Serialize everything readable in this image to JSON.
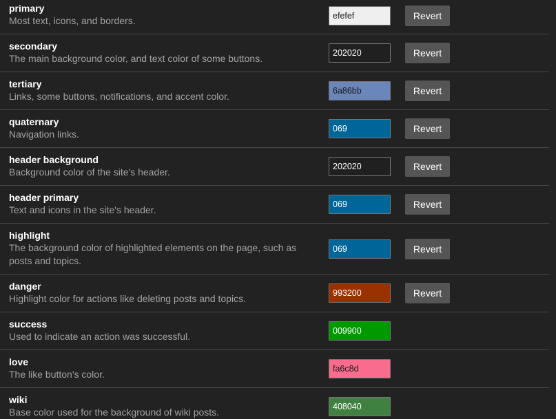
{
  "revert_label": "Revert",
  "colors": [
    {
      "name": "primary",
      "description": "Most text, icons, and borders.",
      "value": "efefef",
      "swatch_bg": "#efefef",
      "swatch_fg": "#222222",
      "has_revert": true
    },
    {
      "name": "secondary",
      "description": "The main background color, and text color of some buttons.",
      "value": "202020",
      "swatch_bg": "#202020",
      "swatch_fg": "#ffffff",
      "has_revert": true
    },
    {
      "name": "tertiary",
      "description": "Links, some buttons, notifications, and accent color.",
      "value": "6a86bb",
      "swatch_bg": "#6a86bb",
      "swatch_fg": "#1a1a1a",
      "has_revert": true
    },
    {
      "name": "quaternary",
      "description": "Navigation links.",
      "value": "069",
      "swatch_bg": "#006699",
      "swatch_fg": "#ffffff",
      "has_revert": true
    },
    {
      "name": "header background",
      "description": "Background color of the site's header.",
      "value": "202020",
      "swatch_bg": "#202020",
      "swatch_fg": "#ffffff",
      "has_revert": true
    },
    {
      "name": "header primary",
      "description": "Text and icons in the site's header.",
      "value": "069",
      "swatch_bg": "#006699",
      "swatch_fg": "#ffffff",
      "has_revert": true
    },
    {
      "name": "highlight",
      "description": "The background color of highlighted elements on the page, such as posts and topics.",
      "value": "069",
      "swatch_bg": "#006699",
      "swatch_fg": "#ffffff",
      "has_revert": true
    },
    {
      "name": "danger",
      "description": "Highlight color for actions like deleting posts and topics.",
      "value": "993200",
      "swatch_bg": "#993200",
      "swatch_fg": "#ffffff",
      "has_revert": true
    },
    {
      "name": "success",
      "description": "Used to indicate an action was successful.",
      "value": "009900",
      "swatch_bg": "#009900",
      "swatch_fg": "#ffffff",
      "has_revert": false
    },
    {
      "name": "love",
      "description": "The like button's color.",
      "value": "fa6c8d",
      "swatch_bg": "#fa6c8d",
      "swatch_fg": "#1a1a1a",
      "has_revert": false
    },
    {
      "name": "wiki",
      "description": "Base color used for the background of wiki posts.",
      "value": "408040",
      "swatch_bg": "#408040",
      "swatch_fg": "#ffffff",
      "has_revert": false
    }
  ]
}
